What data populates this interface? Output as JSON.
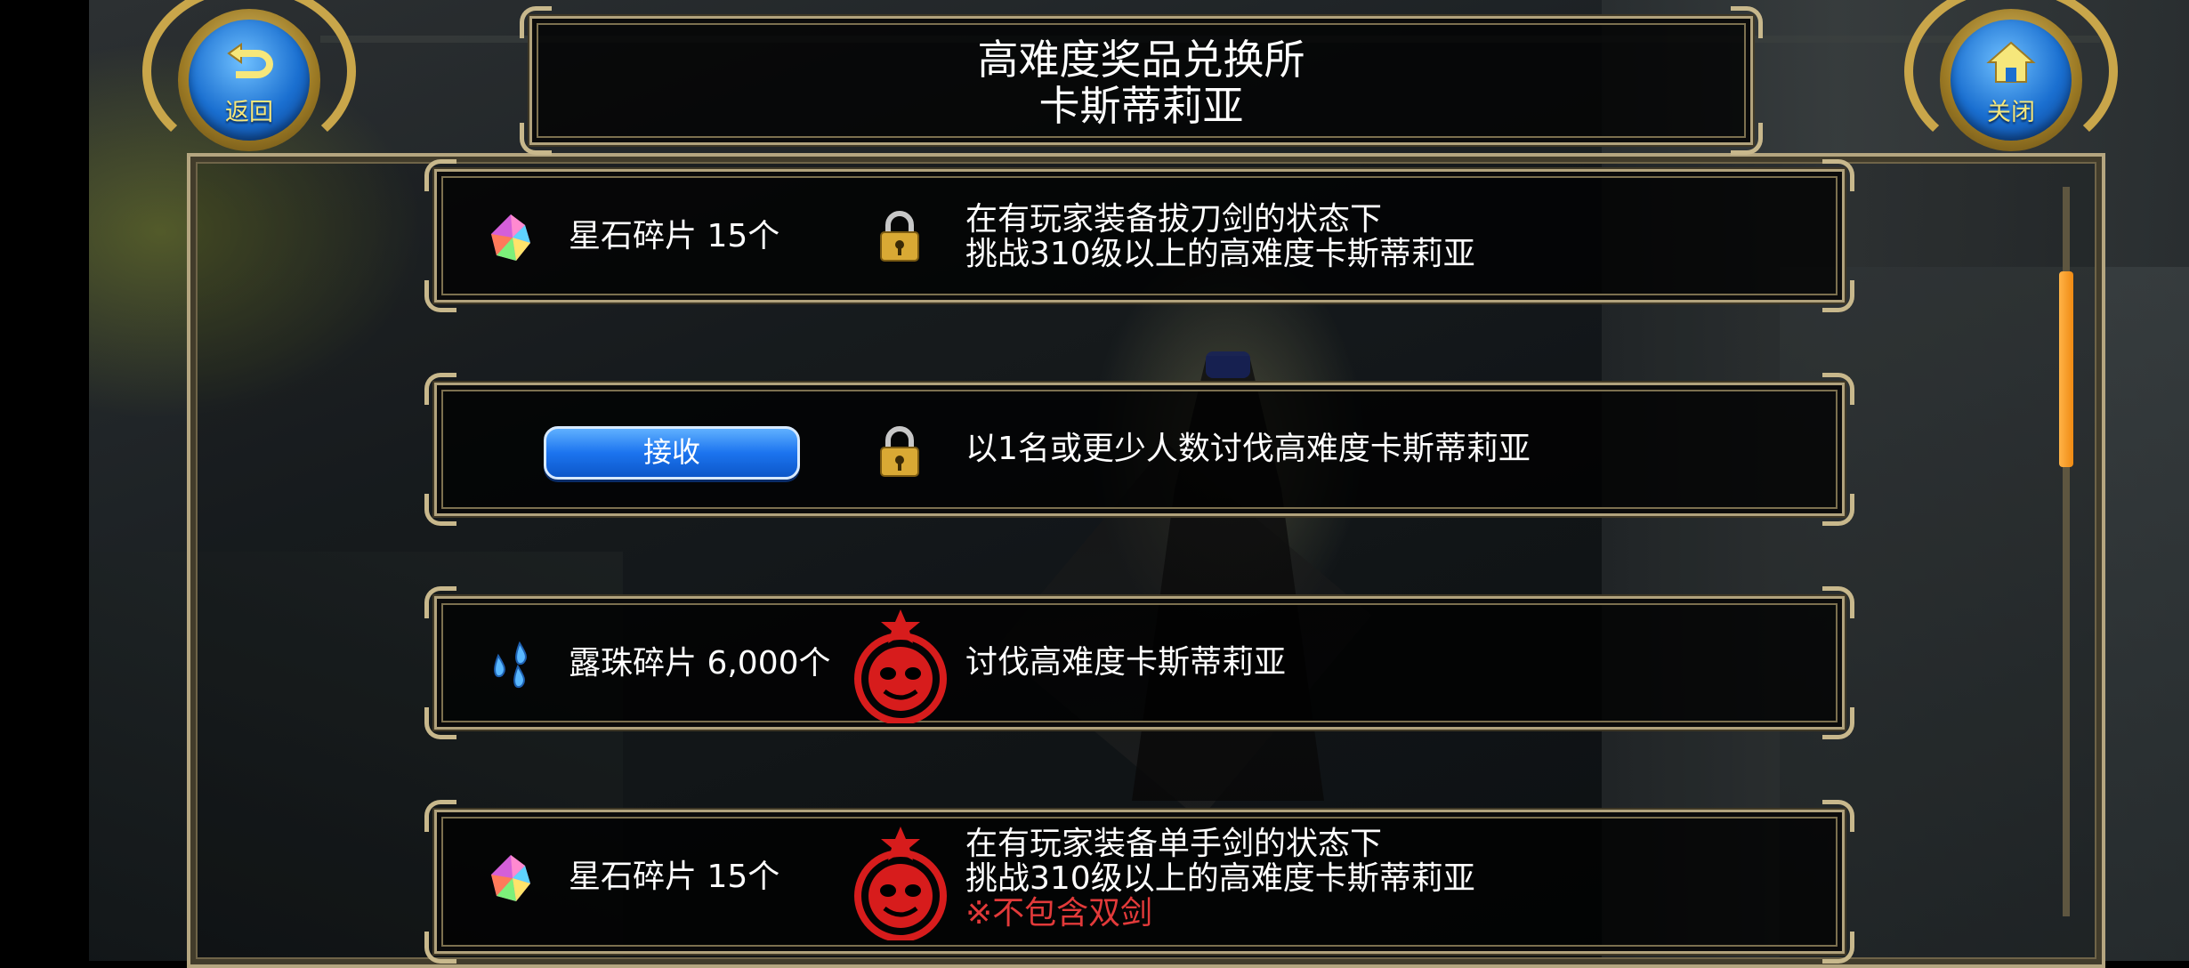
{
  "header": {
    "title_line1": "高难度奖品兑换所",
    "title_line2": "卡斯蒂莉亚",
    "back_label": "返回",
    "close_label": "关闭"
  },
  "rewards": [
    {
      "item_icon": "star-stone-icon",
      "item_name": "星石碎片 15个",
      "status": "locked",
      "condition_line1": "在有玩家装备拔刀剑的状态下",
      "condition_line2": "挑战310级以上的高难度卡斯蒂莉亚"
    },
    {
      "button_label": "接收",
      "status": "locked",
      "condition_line1": "以1名或更少人数讨伐高难度卡斯蒂莉亚"
    },
    {
      "item_icon": "dew-drop-icon",
      "item_name": "露珠碎片 6,000个",
      "status": "completed",
      "condition_line1": "讨伐高难度卡斯蒂莉亚"
    },
    {
      "item_icon": "star-stone-icon",
      "item_name": "星石碎片 15个",
      "status": "completed",
      "condition_line1": "在有玩家装备单手剑的状态下",
      "condition_line2": "挑战310级以上的高难度卡斯蒂莉亚",
      "note": "※不包含双剑"
    }
  ],
  "colors": {
    "accent_button": "#1c74ef",
    "round_button_label": "#f6e77b",
    "warning_text": "#e23a3a",
    "frame_gold": "#b1a27c",
    "seal_red": "#d71c1c"
  }
}
